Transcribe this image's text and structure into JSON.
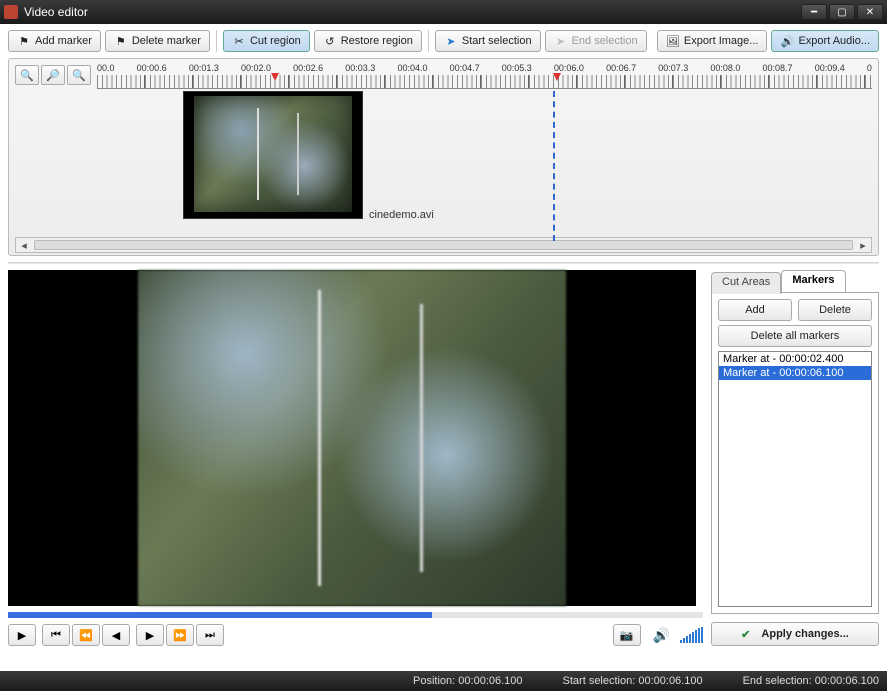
{
  "window": {
    "title": "Video editor"
  },
  "toolbar": {
    "add_marker": "Add marker",
    "delete_marker": "Delete marker",
    "cut_region": "Cut region",
    "restore_region": "Restore region",
    "start_selection": "Start selection",
    "end_selection": "End selection",
    "export_image": "Export Image...",
    "export_audio": "Export Audio..."
  },
  "timeline": {
    "labels": [
      "00.0",
      "00:00.6",
      "00:01.3",
      "00:02.0",
      "00:02.6",
      "00:03.3",
      "00:04.0",
      "00:04.7",
      "00:05.3",
      "00:06.0",
      "00:06.7",
      "00:07.3",
      "00:08.0",
      "00:08.7",
      "00:09.4",
      "0"
    ],
    "clip_name": "cinedemo.avi",
    "marker1_pct": 22.5,
    "playhead_pct": 58.8
  },
  "tabs": {
    "cut_areas": "Cut Areas",
    "markers": "Markers"
  },
  "markers_panel": {
    "add": "Add",
    "delete": "Delete",
    "delete_all": "Delete all markers",
    "items": [
      "Marker at - 00:00:02.400",
      "Marker at - 00:00:06.100"
    ],
    "selected_index": 1
  },
  "apply": "Apply changes...",
  "progress_pct": 61,
  "status": {
    "position_label": "Position:",
    "position_value": "00:00:06.100",
    "start_label": "Start selection:",
    "start_value": "00:00:06.100",
    "end_label": "End selection:",
    "end_value": "00:00:06.100"
  }
}
